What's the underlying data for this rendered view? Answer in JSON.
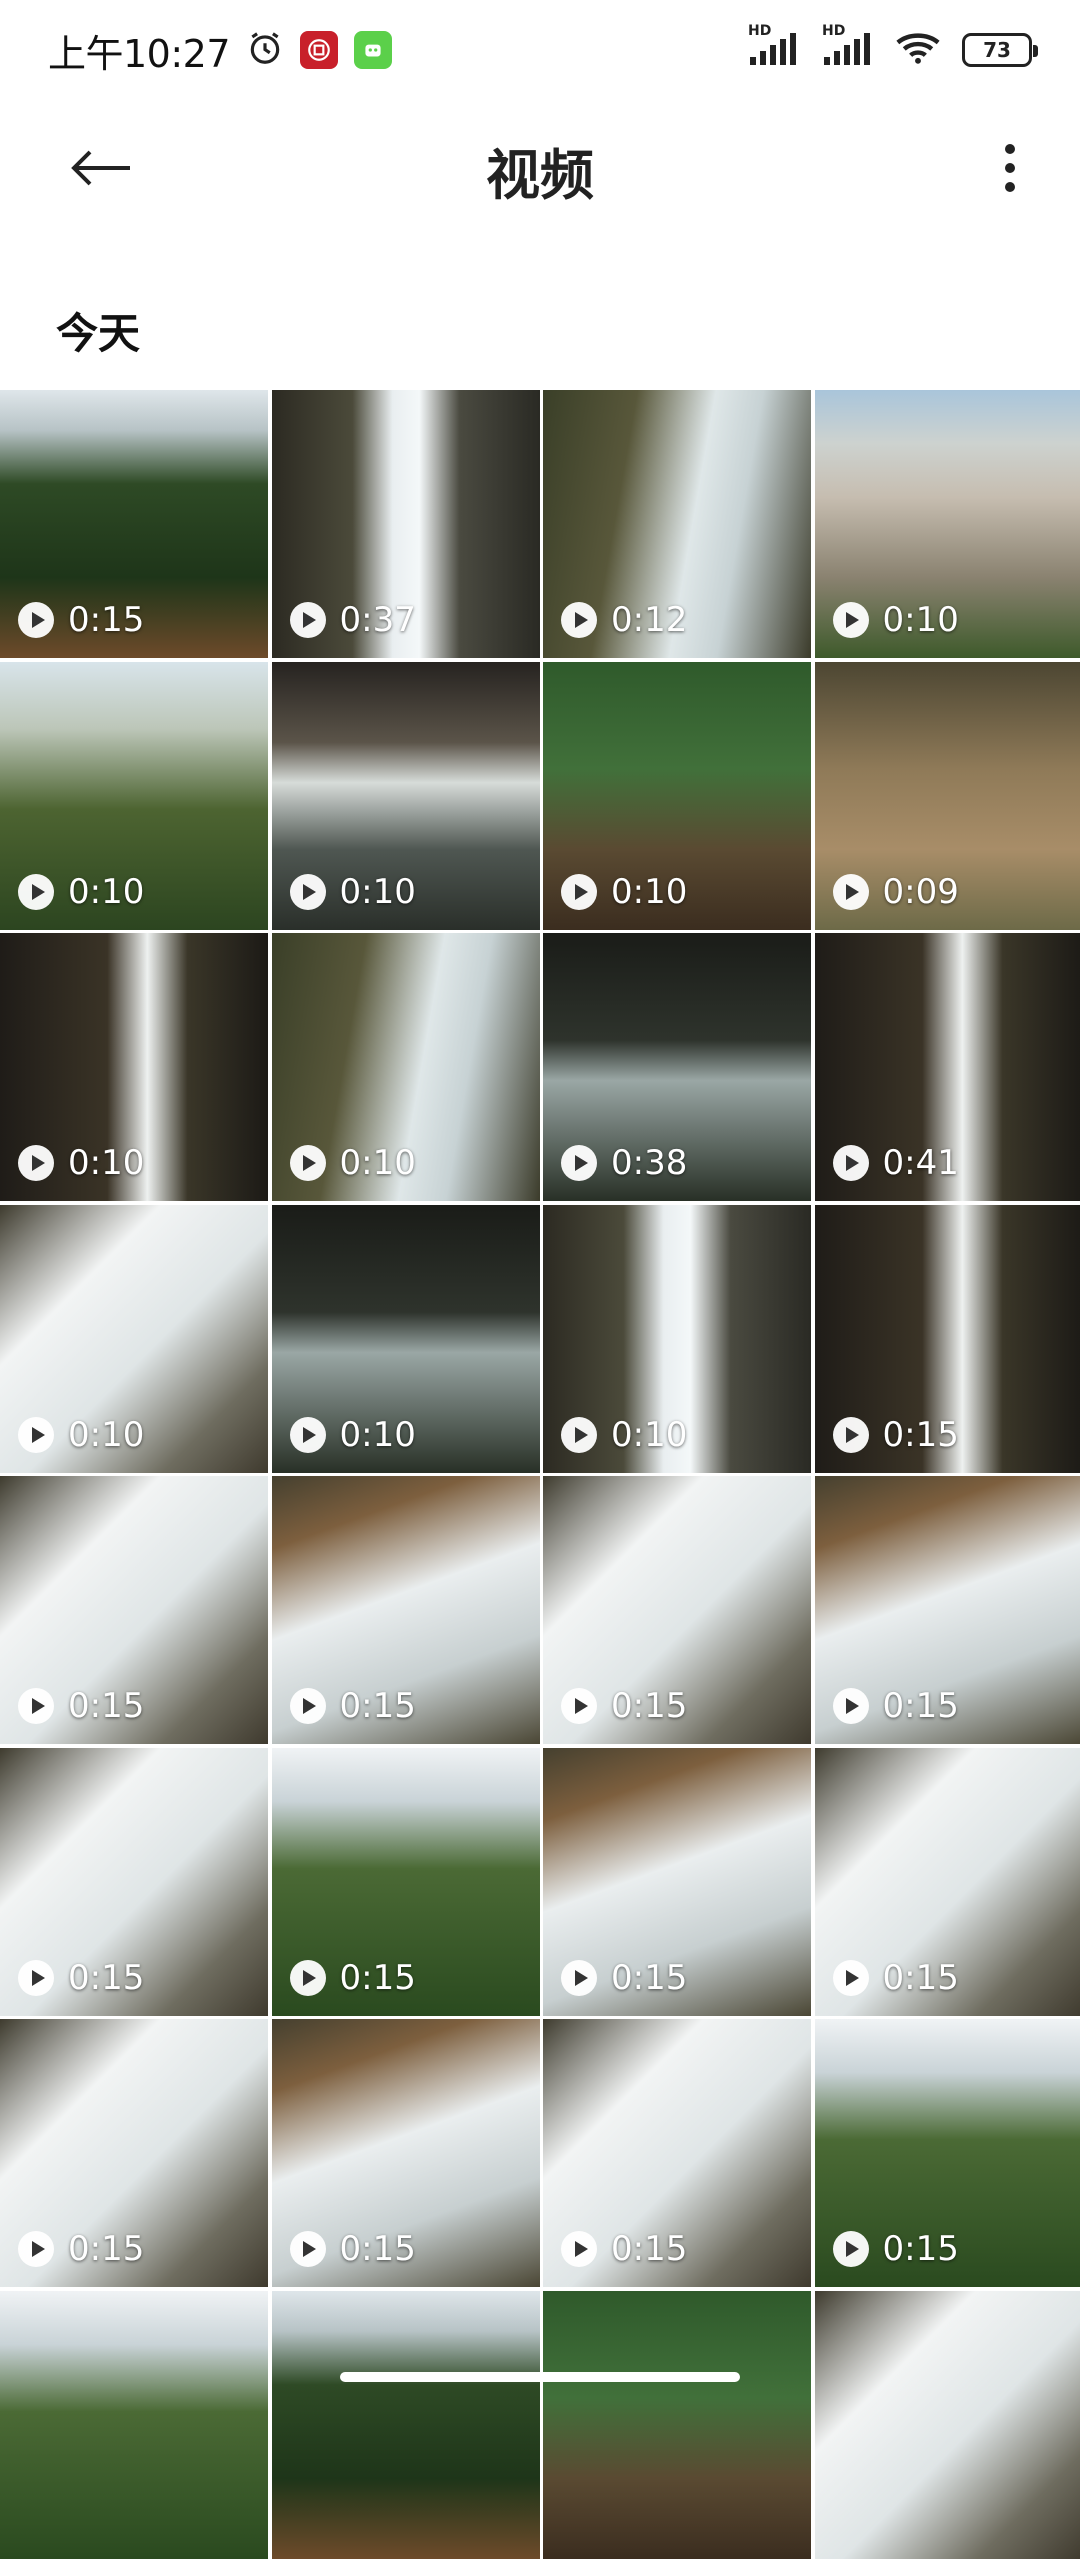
{
  "status_bar": {
    "time": "上午10:27",
    "network_1": "HD",
    "network_2": "HD",
    "battery": "73",
    "icons": [
      "alarm-icon",
      "app-red-icon",
      "app-green-icon",
      "signal-icon",
      "signal-icon",
      "wifi-icon",
      "battery-icon"
    ]
  },
  "header": {
    "title": "视频",
    "back_icon": "arrow-left-icon",
    "more_icon": "more-vertical-icon"
  },
  "section": {
    "label": "今天"
  },
  "videos": [
    {
      "duration": "0:15",
      "style": "v-forest"
    },
    {
      "duration": "0:37",
      "style": "v-fall"
    },
    {
      "duration": "0:12",
      "style": "v-fall2"
    },
    {
      "duration": "0:10",
      "style": "v-rock"
    },
    {
      "duration": "0:10",
      "style": "v-hill"
    },
    {
      "duration": "0:10",
      "style": "v-pool"
    },
    {
      "duration": "0:10",
      "style": "v-jungle"
    },
    {
      "duration": "0:09",
      "style": "v-shallow"
    },
    {
      "duration": "0:10",
      "style": "v-dark"
    },
    {
      "duration": "0:10",
      "style": "v-fall2"
    },
    {
      "duration": "0:38",
      "style": "v-dark2"
    },
    {
      "duration": "0:41",
      "style": "v-dark"
    },
    {
      "duration": "0:10",
      "style": "v-rapid"
    },
    {
      "duration": "0:10",
      "style": "v-dark2"
    },
    {
      "duration": "0:10",
      "style": "v-fall"
    },
    {
      "duration": "0:15",
      "style": "v-dark"
    },
    {
      "duration": "0:15",
      "style": "v-rapid"
    },
    {
      "duration": "0:15",
      "style": "v-rapid2"
    },
    {
      "duration": "0:15",
      "style": "v-rapid"
    },
    {
      "duration": "0:15",
      "style": "v-rapid2"
    },
    {
      "duration": "0:15",
      "style": "v-rapid"
    },
    {
      "duration": "0:15",
      "style": "v-valley"
    },
    {
      "duration": "0:15",
      "style": "v-rapid2"
    },
    {
      "duration": "0:15",
      "style": "v-rapid"
    },
    {
      "duration": "0:15",
      "style": "v-rapid"
    },
    {
      "duration": "0:15",
      "style": "v-rapid2"
    },
    {
      "duration": "0:15",
      "style": "v-rapid"
    },
    {
      "duration": "0:15",
      "style": "v-valley"
    },
    {
      "duration": "",
      "style": "v-valley"
    },
    {
      "duration": "",
      "style": "v-forest"
    },
    {
      "duration": "",
      "style": "v-jungle"
    },
    {
      "duration": "",
      "style": "v-rapid"
    }
  ]
}
